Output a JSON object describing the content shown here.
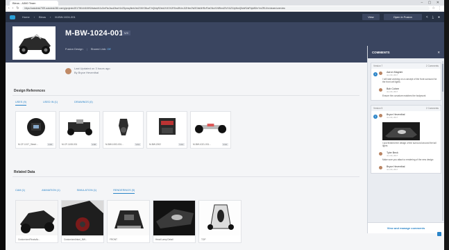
{
  "browser": {
    "tab_title": "Bleus - A360 Team",
    "url": "https://autodesk7929.autodesk360.com/g/projects/20170614410692/data/dXJuOmFkc2sud2lwcHJvZDpmcy5mb2xkZXI6Y28uaTVrQ0dpR2xkUXVlOXJRSmJBVmJ2ZHlmOWZGbkNHRzF0aGNoV1NRbmZ0VXl1Z3JyWmQ5dnR2aFNpMDhrYmZRUVc/viewer/overview",
    "window_controls": "– ▢ ✕"
  },
  "header": {
    "breadcrumb": [
      "Home",
      "Bleus",
      "M-BW-1024-001"
    ],
    "view_button": "View",
    "open_button": "Open in Fusion",
    "icons": [
      "share-icon",
      "download-icon",
      "help-icon"
    ]
  },
  "hero": {
    "title": "M-BW-1024-001",
    "version": "V.9",
    "app": "Fusion Design",
    "share_label": "Shared Link:",
    "share_value": "Off"
  },
  "updated": {
    "line1": "Last Updated on 3 hours ago",
    "line2": "By Bryce Heventhal"
  },
  "design_refs": {
    "title": "Design References",
    "tabs": [
      "USES (9)",
      "USED IN (1)",
      "DRAWINGS (0)"
    ],
    "cards": [
      {
        "caption": "M-CF-1017_Steeri...",
        "badge": "V.16"
      },
      {
        "caption": "M-CF-1108-001",
        "badge": "V.36"
      },
      {
        "caption": "M-BW-1003-001...",
        "badge": "V.41"
      },
      {
        "caption": "M-BW-2002",
        "badge": "V.12"
      },
      {
        "caption": "M-BW-1021-001...",
        "badge": "V.12"
      }
    ]
  },
  "related": {
    "title": "Related Data",
    "tabs": [
      "CAM (1)",
      "ANIMATION (1)",
      "SIMULATION (1)",
      "RENDERINGS (5)"
    ],
    "cards": [
      {
        "caption": "CustomizedFinalsAb..."
      },
      {
        "caption": "CustomizedIntori_BW..."
      },
      {
        "caption": "FRONT"
      },
      {
        "caption": "Head Lamp Detail"
      },
      {
        "caption": "TOP"
      }
    ]
  },
  "comments": {
    "title": "COMMENTS",
    "close": "✕",
    "groups": [
      {
        "label": "Version 7",
        "count": "2 Comments",
        "pin": "1",
        "items": [
          {
            "name": "Aaron Magnini",
            "time": "Jun 09, 2017",
            "text": "I will start working on a concept of the front surround for the front cell lights"
          },
          {
            "name": "Bob Cohee",
            "time": "Jun 09, 2017",
            "text": "Ensure the curvature matches the bodywork"
          }
        ]
      },
      {
        "label": "Version 5",
        "count": "2 Comments",
        "pin": "1",
        "items": [
          {
            "name": "Bryce Heventhal",
            "time": "Jun 09, 2017",
            "text": "I just finished the design of the surround around the tail lights"
          },
          {
            "name": "Tyler Beck",
            "time": "Jun 09, 2017",
            "text": "Make sure you attach a rendering of the new design"
          },
          {
            "name": "Bryce Heventhal",
            "time": "Jun 09, 2017",
            "text": ""
          }
        ]
      }
    ],
    "footer": "View and manage comments"
  }
}
